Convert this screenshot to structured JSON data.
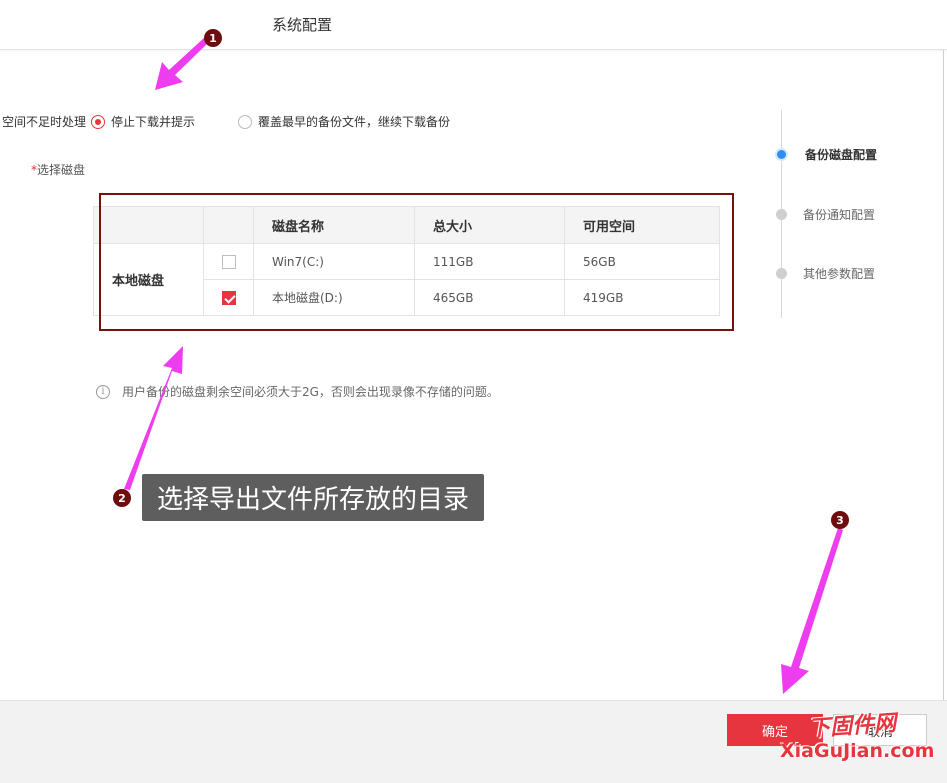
{
  "header": {
    "title": "系统配置"
  },
  "space_policy": {
    "label": "空间不足时处理",
    "options": [
      {
        "label": "停止下载并提示",
        "selected": true
      },
      {
        "label": "覆盖最早的备份文件，继续下载备份",
        "selected": false
      }
    ]
  },
  "select_disk": {
    "required_mark": "*",
    "label": "选择磁盘"
  },
  "disk_table": {
    "headers": [
      "磁盘名称",
      "总大小",
      "可用空间"
    ],
    "group_label": "本地磁盘",
    "rows": [
      {
        "name": "Win7(C:)",
        "total": "111GB",
        "free": "56GB",
        "checked": false
      },
      {
        "name": "本地磁盘(D:)",
        "total": "465GB",
        "free": "419GB",
        "checked": true
      }
    ]
  },
  "note": {
    "icon": "i",
    "text": "用户备份的磁盘剩余空间必须大于2G，否则会出现录像不存储的问题。"
  },
  "steps": [
    {
      "label": "备份磁盘配置",
      "active": true
    },
    {
      "label": "备份通知配置",
      "active": false
    },
    {
      "label": "其他参数配置",
      "active": false
    }
  ],
  "footer": {
    "confirm_label": "确定",
    "cancel_label": "取消"
  },
  "annotations": {
    "markers": [
      "1",
      "2",
      "3"
    ],
    "callout_text": "选择导出文件所存放的目录",
    "arrow_color": "#ee3dee",
    "marker_color": "#6d0d0d"
  },
  "watermark": {
    "cn": "下固件网",
    "en": "XiaGuJian.com"
  },
  "colors": {
    "accent": "#e7353f",
    "step_active": "#2f8ef3",
    "highlight_border": "#7a0f10"
  }
}
